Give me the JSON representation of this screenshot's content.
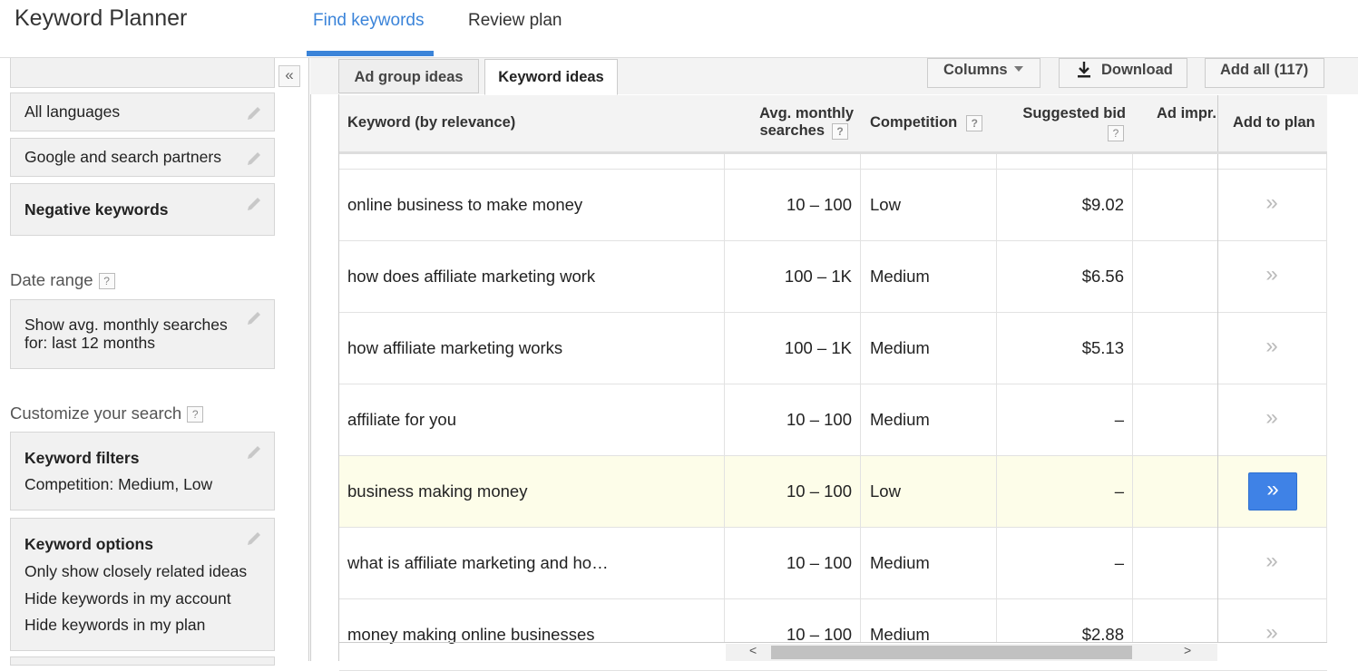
{
  "header": {
    "app_title": "Keyword Planner",
    "tabs": [
      {
        "label": "Find keywords",
        "active": true
      },
      {
        "label": "Review plan",
        "active": false
      }
    ],
    "accent_color": "#3b84d9"
  },
  "sidebar": {
    "collapse_glyph": "«",
    "language": "All languages",
    "network": "Google and search partners",
    "negative_keywords": "Negative keywords",
    "date_range": {
      "label": "Date range",
      "help": "?",
      "value_line1": "Show avg. monthly searches",
      "value_line2": "for: last 12 months"
    },
    "customize": {
      "label": "Customize your search",
      "help": "?"
    },
    "keyword_filters": {
      "title": "Keyword filters",
      "value": "Competition: Medium, Low"
    },
    "keyword_options": {
      "title": "Keyword options",
      "items": [
        "Only show closely related ideas",
        "Hide keywords in my account",
        "Hide keywords in my plan"
      ]
    }
  },
  "subtabs": {
    "ad_group_ideas": "Ad group ideas",
    "keyword_ideas": "Keyword ideas",
    "active": "Keyword ideas"
  },
  "toolbar": {
    "columns": "Columns",
    "download": "Download",
    "add_all": "Add all (117)"
  },
  "table": {
    "headers": {
      "keyword": "Keyword (by relevance)",
      "avg_line1": "Avg. monthly",
      "avg_line2": "searches",
      "competition": "Competition",
      "suggested_bid": "Suggested bid",
      "ad_impr": "Ad impr.",
      "add_to_plan": "Add to plan",
      "help": "?"
    },
    "add_glyph": "»",
    "rows": [
      {
        "keyword": "online business to make money",
        "avg": "10 – 100",
        "competition": "Low",
        "bid": "$9.02",
        "ad_impr": ""
      },
      {
        "keyword": "how does affiliate marketing work",
        "avg": "100 – 1K",
        "competition": "Medium",
        "bid": "$6.56",
        "ad_impr": ""
      },
      {
        "keyword": "how affiliate marketing works",
        "avg": "100 – 1K",
        "competition": "Medium",
        "bid": "$5.13",
        "ad_impr": ""
      },
      {
        "keyword": "affiliate for you",
        "avg": "10 – 100",
        "competition": "Medium",
        "bid": "–",
        "ad_impr": ""
      },
      {
        "keyword": "business making money",
        "avg": "10 – 100",
        "competition": "Low",
        "bid": "–",
        "ad_impr": "",
        "highlighted": true
      },
      {
        "keyword": "what is affiliate marketing and ho…",
        "avg": "10 – 100",
        "competition": "Medium",
        "bid": "–",
        "ad_impr": ""
      },
      {
        "keyword": "money making online businesses",
        "avg": "10 – 100",
        "competition": "Medium",
        "bid": "$2.88",
        "ad_impr": ""
      }
    ]
  },
  "scrollbar": {
    "left_glyph": "<",
    "right_glyph": ">"
  }
}
